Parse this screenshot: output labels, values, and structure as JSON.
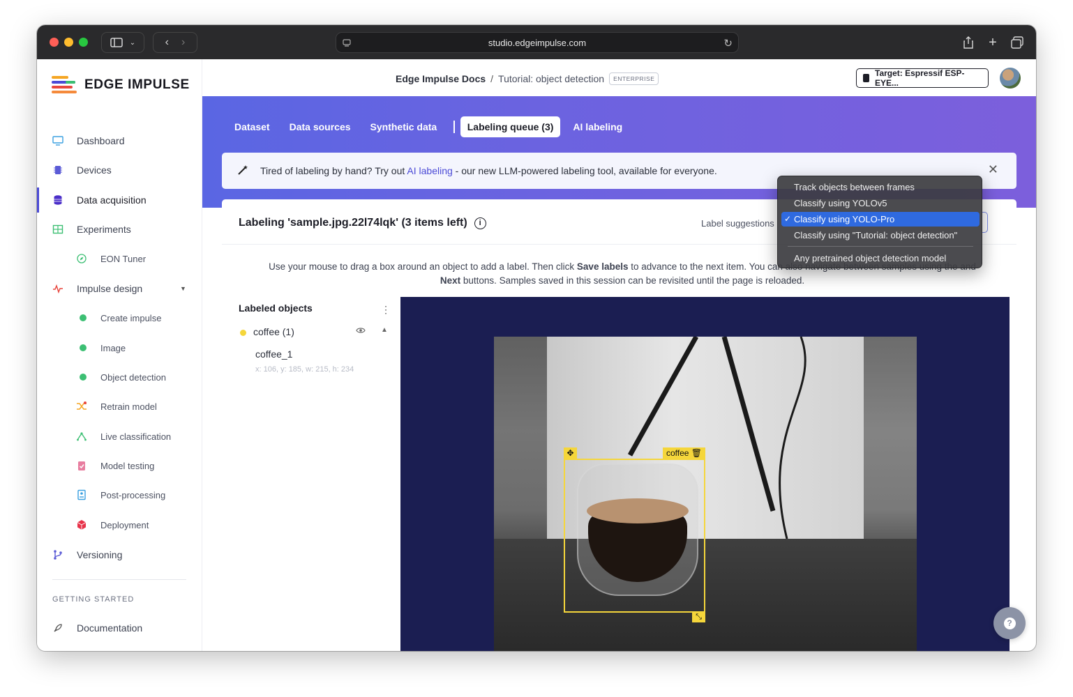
{
  "browser": {
    "url": "studio.edgeimpulse.com"
  },
  "brand": {
    "name": "EDGE IMPULSE"
  },
  "sidebar": {
    "items": [
      {
        "label": "Dashboard",
        "icon": "monitor-icon"
      },
      {
        "label": "Devices",
        "icon": "chip-icon"
      },
      {
        "label": "Data acquisition",
        "icon": "database-icon",
        "active": true
      },
      {
        "label": "Experiments",
        "icon": "grid-icon"
      },
      {
        "label": "EON Tuner",
        "icon": "compass-icon"
      },
      {
        "label": "Impulse design",
        "icon": "pulse-icon"
      },
      {
        "label": "Create impulse",
        "icon": "green-dot-icon"
      },
      {
        "label": "Image",
        "icon": "green-dot-icon"
      },
      {
        "label": "Object detection",
        "icon": "green-dot-icon"
      },
      {
        "label": "Retrain model",
        "icon": "shuffle-icon"
      },
      {
        "label": "Live classification",
        "icon": "live-icon"
      },
      {
        "label": "Model testing",
        "icon": "clipboard-icon"
      },
      {
        "label": "Post-processing",
        "icon": "post-processing-icon"
      },
      {
        "label": "Deployment",
        "icon": "cube-icon"
      },
      {
        "label": "Versioning",
        "icon": "branch-icon"
      }
    ],
    "section_getting_started": "GETTING STARTED",
    "documentation": "Documentation"
  },
  "header": {
    "project": "Edge Impulse Docs",
    "separator": "/",
    "page": "Tutorial: object detection",
    "badge": "ENTERPRISE",
    "target": "Target: Espressif ESP-EYE..."
  },
  "tabs": [
    {
      "label": "Dataset"
    },
    {
      "label": "Data sources"
    },
    {
      "label": "Synthetic data"
    },
    {
      "label": "Labeling queue (3)",
      "active": true
    },
    {
      "label": "AI labeling"
    }
  ],
  "banner": {
    "prefix": "Tired of labeling by hand? Try out ",
    "link": "AI labeling",
    "suffix": " - our new LLM-powered labeling tool, available for everyone."
  },
  "card": {
    "title": "Labeling 'sample.jpg.22l74lqk' (3 items left)",
    "suggestions_label": "Label suggestions",
    "instructions_a": "Use your mouse to drag a box around an object to add a label. Then click ",
    "instructions_bold1": "Save labels",
    "instructions_b": " to advance to the next item. You can also navigate between samples using the ",
    "instructions_c": " and",
    "instructions_bold2": "Next",
    "instructions_d": " buttons. Samples saved in this session can be revisited until the page is reloaded."
  },
  "labeled_objects": {
    "heading": "Labeled objects",
    "group_label": "coffee (1)",
    "item_name": "coffee_1",
    "item_coords": "x: 106, y: 185, w: 215, h: 234"
  },
  "bounding_box": {
    "label": "coffee",
    "color": "#f5d63b"
  },
  "dropdown": {
    "options": [
      {
        "label": "Track objects between frames",
        "selected": false
      },
      {
        "label": "Classify using YOLOv5",
        "selected": false
      },
      {
        "label": "Classify using YOLO-Pro",
        "selected": true
      },
      {
        "label": "Classify using \"Tutorial: object detection\"",
        "selected": false
      },
      {
        "label": "Any pretrained object detection model",
        "selected": false
      }
    ],
    "check": "✓"
  },
  "colors": {
    "accent": "#4b4ad6",
    "hero_start": "#5a66e3",
    "hero_end": "#7c5fdc",
    "canvas_bg": "#1b1e52"
  }
}
